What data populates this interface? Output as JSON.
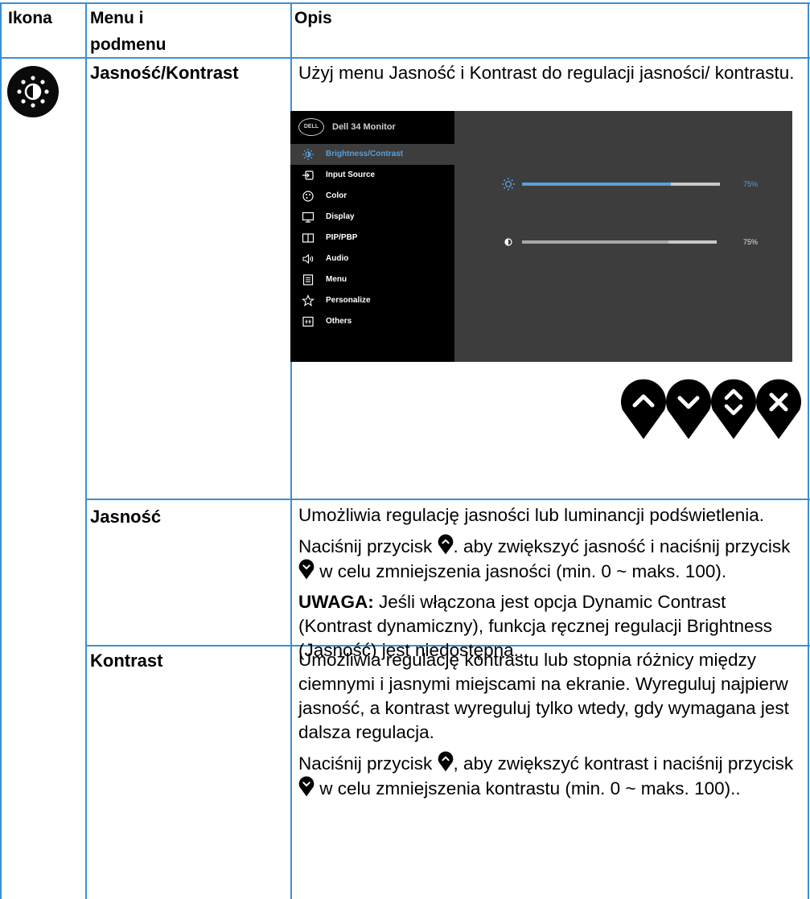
{
  "header": {
    "col1": "Ikona",
    "col2_line1": "Menu i",
    "col2_line2": "podmenu",
    "col3": "Opis"
  },
  "rows": {
    "jasnosc_kontrast": {
      "icon": "brightness-icon",
      "name": "Jasność/Kontrast",
      "desc": "Użyj menu Jasność i Kontrast do regulacji jasności/ kontrastu."
    },
    "jasnosc": {
      "name": "Jasność",
      "p1": "Umożliwia regulację jasności lub luminancji podświetlenia.",
      "p2a": "Naciśnij przycisk",
      "p2b": ". aby zwiększyć jasność i naciśnij przycisk",
      "p2c": "w celu zmniejszenia jasności (min. 0 ~ maks. 100).",
      "note_label": "UWAGA:",
      "note_text": " Jeśli włączona jest opcja Dynamic Contrast (Kontrast dynamiczny), funkcja ręcznej regulacji Brightness (Jasność) jest niedostępna.."
    },
    "kontrast": {
      "name": "Kontrast",
      "p1": "Umożliwia regulację kontrastu lub stopnia różnicy między ciemnymi i jasnymi miejscami na ekranie. Wyreguluj najpierw jasność, a kontrast wyreguluj tylko wtedy, gdy wymagana jest dalsza regulacja.",
      "p2a": "Naciśnij przycisk",
      "p2b": ", aby zwiększyć kontrast i naciśnij przycisk",
      "p2c": "w celu zmniejszenia kontrastu (min. 0 ~ maks. 100).."
    }
  },
  "osd": {
    "logo": "DELL",
    "title": "Dell 34 Monitor",
    "menu": [
      {
        "label": "Brightness/Contrast",
        "icon": "brightness-icon",
        "active": true
      },
      {
        "label": "Input Source",
        "icon": "input-source-icon",
        "active": false
      },
      {
        "label": "Color",
        "icon": "color-palette-icon",
        "active": false
      },
      {
        "label": "Display",
        "icon": "display-icon",
        "active": false
      },
      {
        "label": "PIP/PBP",
        "icon": "pip-pbp-icon",
        "active": false
      },
      {
        "label": "Audio",
        "icon": "speaker-icon",
        "active": false
      },
      {
        "label": "Menu",
        "icon": "menu-list-icon",
        "active": false
      },
      {
        "label": "Personalize",
        "icon": "star-icon",
        "active": false
      },
      {
        "label": "Others",
        "icon": "others-icon",
        "active": false
      }
    ],
    "brightness": {
      "value": 75,
      "label": "75%",
      "icon": "brightness-icon"
    },
    "contrast": {
      "value": 75,
      "label": "75%",
      "icon": "contrast-icon"
    },
    "buttons": [
      "up-arrow-icon",
      "down-arrow-icon",
      "up-down-icon",
      "close-icon"
    ]
  },
  "colors": {
    "table_border": "#3b8fd4",
    "osd_active": "#5a9fd9",
    "brightness_fill": "#5a9fd9",
    "contrast_fill": "#a8a8a8"
  }
}
